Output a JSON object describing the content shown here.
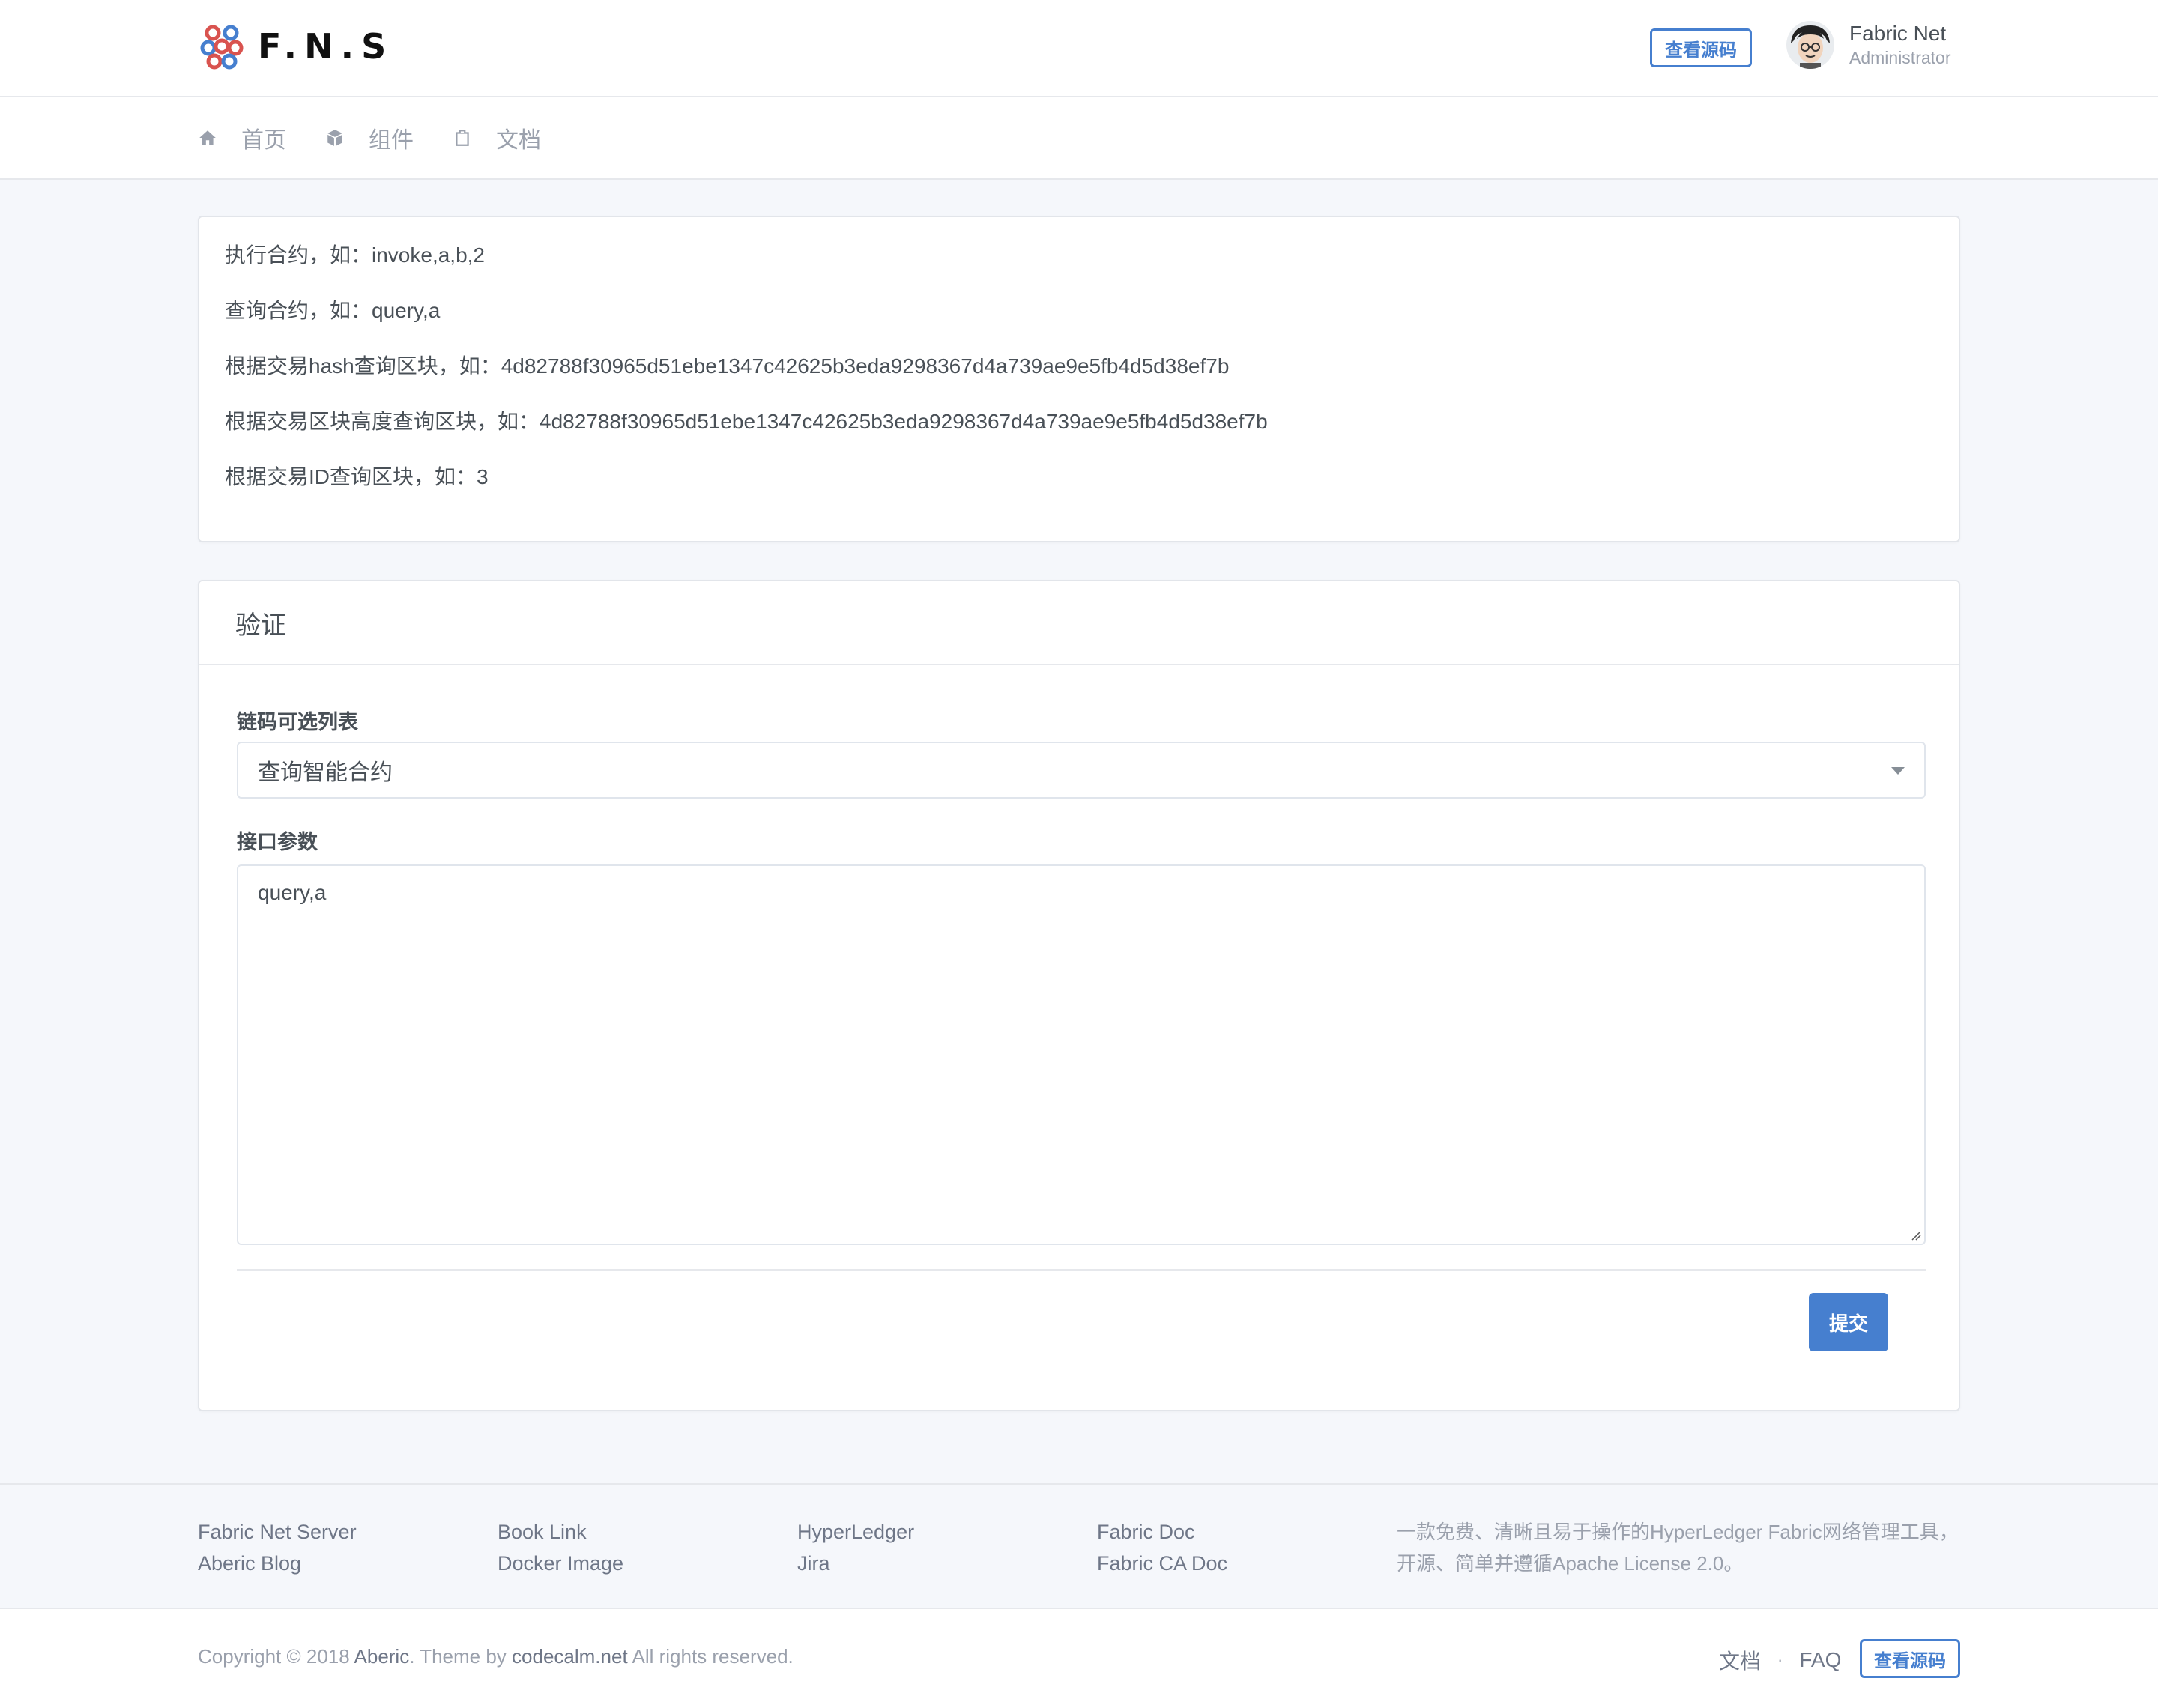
{
  "header": {
    "logo_text": "F.N.S",
    "source_button": "查看源码",
    "user_name": "Fabric Net",
    "user_role": "Administrator"
  },
  "nav": {
    "items": [
      {
        "label": "首页",
        "icon": "home-icon"
      },
      {
        "label": "组件",
        "icon": "box-icon"
      },
      {
        "label": "文档",
        "icon": "clipboard-icon"
      }
    ]
  },
  "info": {
    "lines": [
      "执行合约，如：invoke,a,b,2",
      "查询合约，如：query,a",
      "根据交易hash查询区块，如：4d82788f30965d51ebe1347c42625b3eda9298367d4a739ae9e5fb4d5d38ef7b",
      "根据交易区块高度查询区块，如：4d82788f30965d51ebe1347c42625b3eda9298367d4a739ae9e5fb4d5d38ef7b",
      "根据交易ID查询区块，如：3"
    ]
  },
  "form": {
    "title": "验证",
    "select_label": "链码可选列表",
    "select_value": "查询智能合约",
    "params_label": "接口参数",
    "params_value": "query,a",
    "submit_label": "提交"
  },
  "footer": {
    "columns": [
      [
        "Fabric Net Server",
        "Aberic Blog"
      ],
      [
        "Book Link",
        "Docker Image"
      ],
      [
        "HyperLedger",
        "Jira"
      ],
      [
        "Fabric Doc",
        "Fabric CA Doc"
      ]
    ],
    "description": "一款免费、清晰且易于操作的HyperLedger Fabric网络管理工具，开源、简单并遵循Apache License 2.0。",
    "copyright_prefix": "Copyright © 2018 ",
    "copyright_author": "Aberic",
    "copyright_mid": ". Theme by ",
    "copyright_theme": "codecalm.net",
    "copyright_suffix": " All rights reserved.",
    "link_docs": "文档",
    "link_sep": "·",
    "link_faq": "FAQ",
    "source_button": "查看源码"
  },
  "colors": {
    "primary": "#467fcf",
    "background": "#f5f7fb"
  }
}
